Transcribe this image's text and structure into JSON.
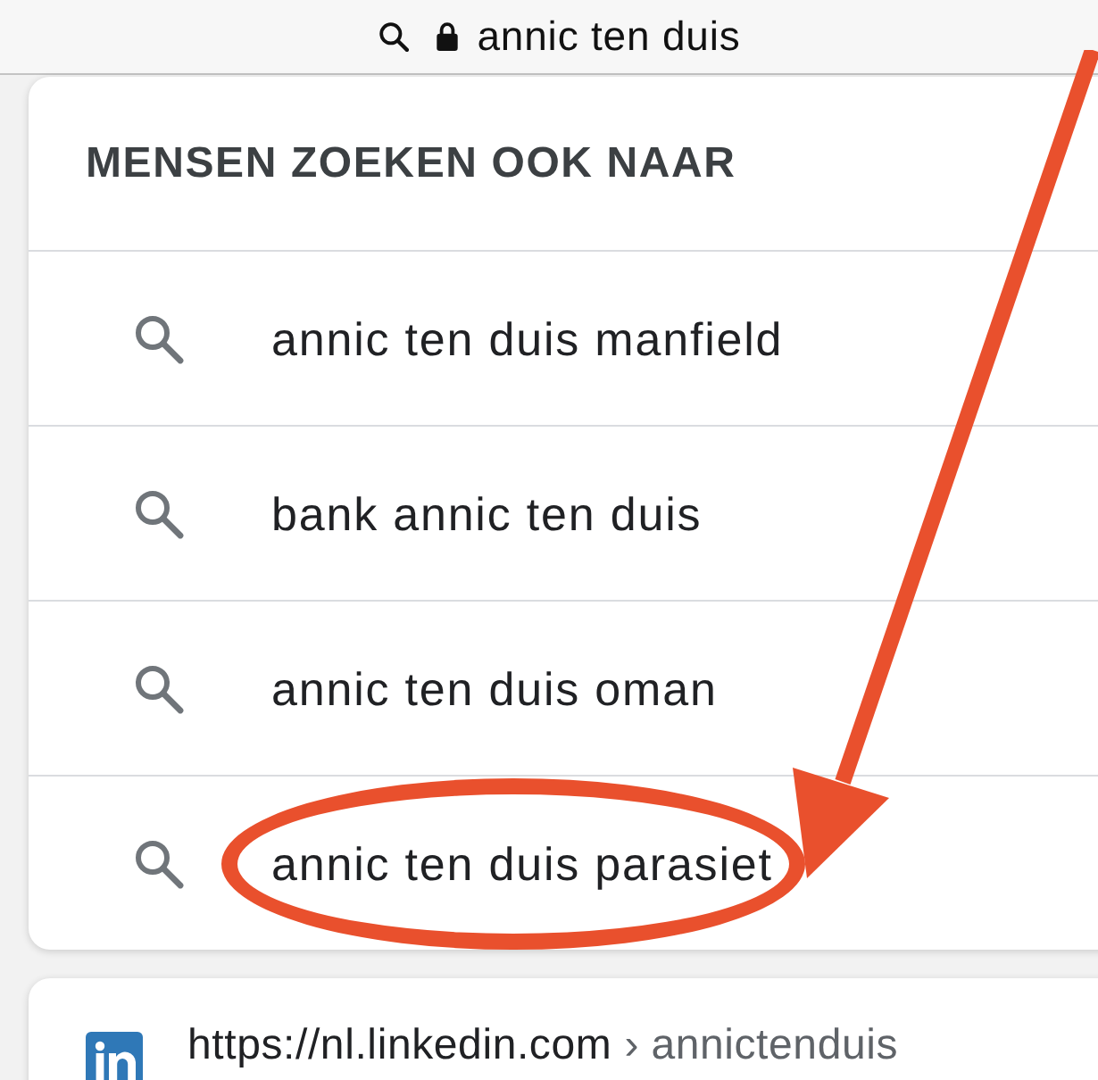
{
  "address_bar": {
    "text": "annic ten duis"
  },
  "related_searches": {
    "title": "MENSEN ZOEKEN OOK NAAR",
    "items": [
      {
        "text": "annic ten duis manfield",
        "highlighted": false
      },
      {
        "text": "bank annic ten duis",
        "highlighted": false
      },
      {
        "text": "annic ten duis oman",
        "highlighted": false
      },
      {
        "text": "annic ten duis parasiet",
        "highlighted": true
      }
    ]
  },
  "result": {
    "url": "https://nl.linkedin.com",
    "separator": "›",
    "path": "annictenduis"
  }
}
